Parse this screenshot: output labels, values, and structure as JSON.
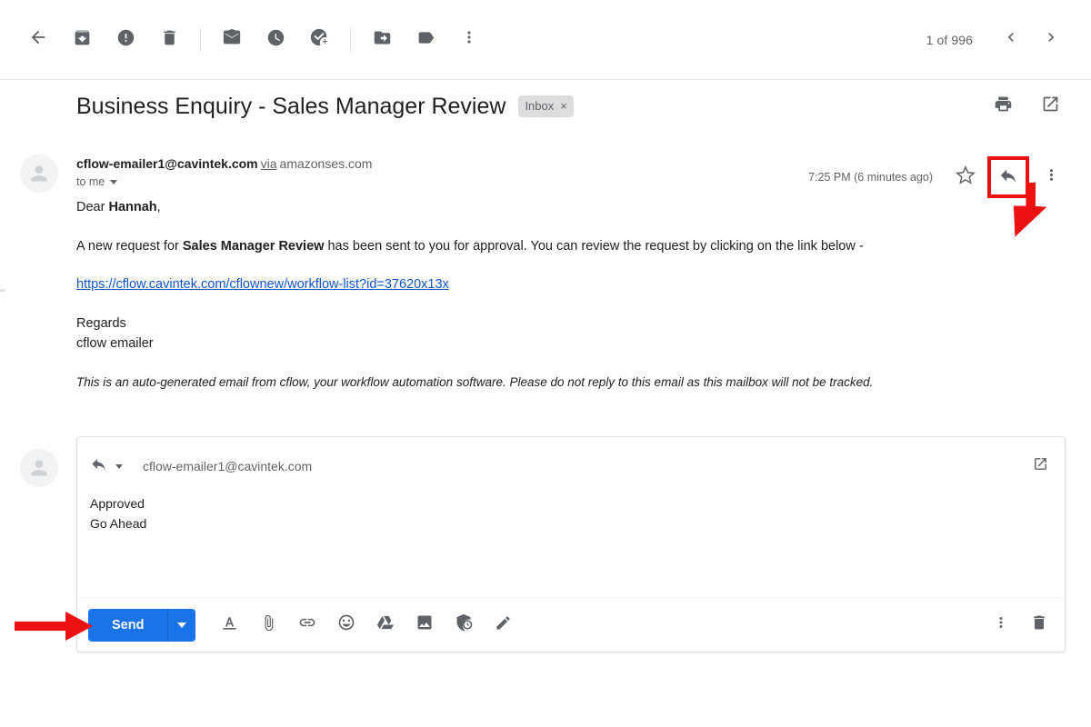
{
  "toolbar": {
    "back_label": "Back",
    "icons": [
      {
        "name": "back-icon",
        "label": "Back to Inbox"
      },
      {
        "name": "archive-icon",
        "label": "Archive"
      },
      {
        "name": "report-spam-icon",
        "label": "Report spam"
      },
      {
        "name": "delete-icon",
        "label": "Delete"
      },
      {
        "name": "mark-unread-icon",
        "label": "Mark as unread"
      },
      {
        "name": "snooze-icon",
        "label": "Snooze"
      },
      {
        "name": "add-to-tasks-icon",
        "label": "Add to Tasks"
      },
      {
        "name": "move-to-icon",
        "label": "Move to"
      },
      {
        "name": "labels-icon",
        "label": "Labels"
      },
      {
        "name": "more-options-icon",
        "label": "More"
      }
    ],
    "pager_text": "1 of 996",
    "prev_label": "Newer",
    "next_label": "Older"
  },
  "subject": {
    "title": "Business Enquiry - Sales Manager Review",
    "label_chip": "Inbox",
    "label_chip_remove": "×",
    "print_label": "Print all",
    "popout_label": "Open in new window"
  },
  "message": {
    "sender": "cflow-emailer1@cavintek.com",
    "via_word": "via",
    "via_domain": "amazonses.com",
    "to_line": "to me",
    "timestamp": "7:25 PM (6 minutes ago)",
    "star_label": "Star",
    "reply_label": "Reply",
    "more_label": "More"
  },
  "body": {
    "greeting_prefix": "Dear ",
    "greeting_name": "Hannah",
    "greeting_suffix": ",",
    "para_prefix": "A new request for ",
    "para_bold": "Sales Manager Review",
    "para_suffix": " has been sent to you for approval. You can review the request by clicking on the link below -",
    "link": "https://cflow.cavintek.com/cflownew/workflow-list?id=37620x13x",
    "regards_line1": "Regards",
    "regards_line2": "cflow emailer",
    "disclaimer": "This is an auto-generated email from cflow, your workflow automation software. Please do not reply to this email as this mailbox will not be tracked."
  },
  "compose": {
    "recipient": "cflow-emailer1@cavintek.com",
    "reply_mode_label": "Reply",
    "popout_label": "Pop out reply",
    "message_line1": "Approved",
    "message_line2": "Go Ahead",
    "send_label": "Send",
    "send_options_label": "More send options",
    "tools": [
      {
        "name": "formatting-options-icon",
        "label": "Formatting options"
      },
      {
        "name": "attach-file-icon",
        "label": "Attach files"
      },
      {
        "name": "insert-link-icon",
        "label": "Insert link"
      },
      {
        "name": "insert-emoji-icon",
        "label": "Insert emoji"
      },
      {
        "name": "insert-drive-file-icon",
        "label": "Insert files using Drive"
      },
      {
        "name": "insert-photo-icon",
        "label": "Insert photo"
      },
      {
        "name": "confidential-mode-icon",
        "label": "Toggle confidential mode"
      },
      {
        "name": "insert-signature-icon",
        "label": "Insert signature"
      }
    ],
    "more_options_label": "More options",
    "discard_label": "Discard draft"
  },
  "annotations": {
    "highlight_color": "#ee1111",
    "reply_button_highlight": true,
    "send_button_arrow": true
  }
}
